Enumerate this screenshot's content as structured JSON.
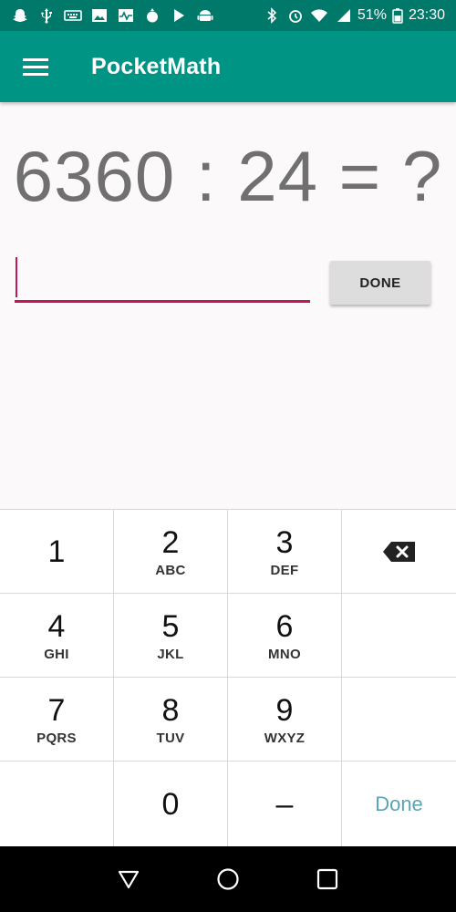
{
  "status_bar": {
    "battery_percent": "51%",
    "time": "23:30",
    "left_icons": [
      "snapchat-icon",
      "usb-icon",
      "keyboard-icon",
      "image-icon",
      "pulse-icon",
      "pomegranate-icon",
      "play-store-icon",
      "android-icon"
    ],
    "right_icons": [
      "bluetooth-icon",
      "alarm-icon",
      "wifi-icon",
      "signal-icon",
      "battery-icon"
    ]
  },
  "app_bar": {
    "title": "PocketMath",
    "menu_icon": "hamburger-menu-icon",
    "color": "#009485"
  },
  "problem": {
    "text": "6360 : 24 = ?"
  },
  "answer": {
    "value": "",
    "accent_color": "#c2185b"
  },
  "done_button": {
    "label": "DONE"
  },
  "keypad": {
    "keys": [
      {
        "digit": "1",
        "letters": ""
      },
      {
        "digit": "2",
        "letters": "ABC"
      },
      {
        "digit": "3",
        "letters": "DEF"
      },
      {
        "digit": "",
        "letters": "",
        "icon": "backspace-icon"
      },
      {
        "digit": "4",
        "letters": "GHI"
      },
      {
        "digit": "5",
        "letters": "JKL"
      },
      {
        "digit": "6",
        "letters": "MNO"
      },
      {
        "digit": "",
        "letters": ""
      },
      {
        "digit": "7",
        "letters": "PQRS"
      },
      {
        "digit": "8",
        "letters": "TUV"
      },
      {
        "digit": "9",
        "letters": "WXYZ"
      },
      {
        "digit": "",
        "letters": ""
      },
      {
        "digit": "",
        "letters": ""
      },
      {
        "digit": "0",
        "letters": ""
      },
      {
        "digit": "–",
        "letters": ""
      },
      {
        "digit": "",
        "letters": "",
        "label": "Done"
      }
    ],
    "done_color": "#5aa3b5"
  },
  "nav_bar": {
    "buttons": [
      "back-icon",
      "home-icon",
      "recents-icon"
    ]
  }
}
